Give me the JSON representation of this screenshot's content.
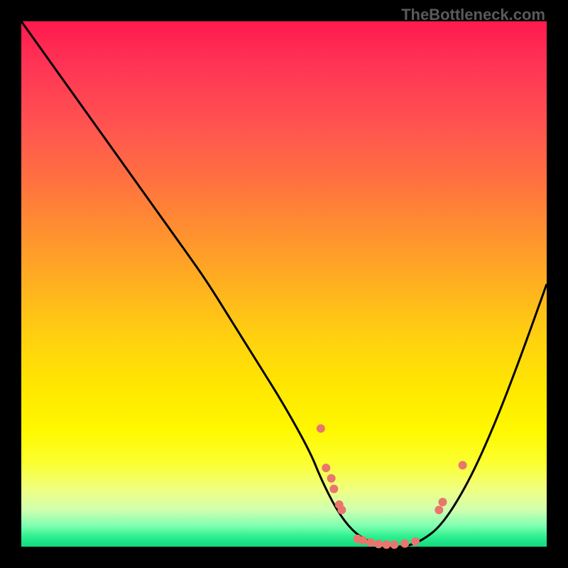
{
  "watermark": "TheBottleneck.com",
  "chart_data": {
    "type": "line",
    "title": "",
    "xlabel": "",
    "ylabel": "",
    "xlim": [
      0,
      100
    ],
    "ylim": [
      0,
      100
    ],
    "background_gradient": {
      "top_color": "#ff1a4d",
      "mid_color": "#ffe000",
      "bottom_color": "#10d880"
    },
    "series": [
      {
        "name": "curve",
        "x": [
          0,
          5,
          10,
          15,
          20,
          25,
          30,
          35,
          40,
          45,
          50,
          55,
          57,
          60,
          63,
          66,
          70,
          73,
          76,
          80,
          85,
          90,
          95,
          100
        ],
        "y": [
          100,
          93,
          86,
          79,
          72,
          65,
          58,
          51,
          43,
          35,
          27,
          18,
          13,
          7,
          3,
          1,
          0,
          0,
          1,
          4,
          12,
          23,
          36,
          50
        ],
        "stroke": "#000000",
        "stroke_width": 3
      }
    ],
    "markers": [
      {
        "x": 57.0,
        "y": 22.5,
        "r": 6,
        "color": "#e8766d"
      },
      {
        "x": 58.0,
        "y": 15.0,
        "r": 6,
        "color": "#e8766d"
      },
      {
        "x": 59.0,
        "y": 13.0,
        "r": 6,
        "color": "#e8766d"
      },
      {
        "x": 59.5,
        "y": 11.0,
        "r": 6,
        "color": "#e8766d"
      },
      {
        "x": 60.5,
        "y": 8.0,
        "r": 6,
        "color": "#e8766d"
      },
      {
        "x": 61.0,
        "y": 7.0,
        "r": 6,
        "color": "#e8766d"
      },
      {
        "x": 64.0,
        "y": 1.5,
        "r": 6,
        "color": "#e8766d"
      },
      {
        "x": 65.0,
        "y": 1.2,
        "r": 6,
        "color": "#e8766d"
      },
      {
        "x": 66.5,
        "y": 0.8,
        "r": 6,
        "color": "#e8766d"
      },
      {
        "x": 68.0,
        "y": 0.5,
        "r": 6,
        "color": "#e8766d"
      },
      {
        "x": 69.5,
        "y": 0.4,
        "r": 6,
        "color": "#e8766d"
      },
      {
        "x": 71.0,
        "y": 0.4,
        "r": 6,
        "color": "#e8766d"
      },
      {
        "x": 73.0,
        "y": 0.6,
        "r": 6,
        "color": "#e8766d"
      },
      {
        "x": 75.0,
        "y": 1.0,
        "r": 6,
        "color": "#e8766d"
      },
      {
        "x": 79.5,
        "y": 7.0,
        "r": 6,
        "color": "#e8766d"
      },
      {
        "x": 80.2,
        "y": 8.5,
        "r": 6,
        "color": "#e8766d"
      },
      {
        "x": 84.0,
        "y": 15.5,
        "r": 6,
        "color": "#e8766d"
      }
    ]
  }
}
